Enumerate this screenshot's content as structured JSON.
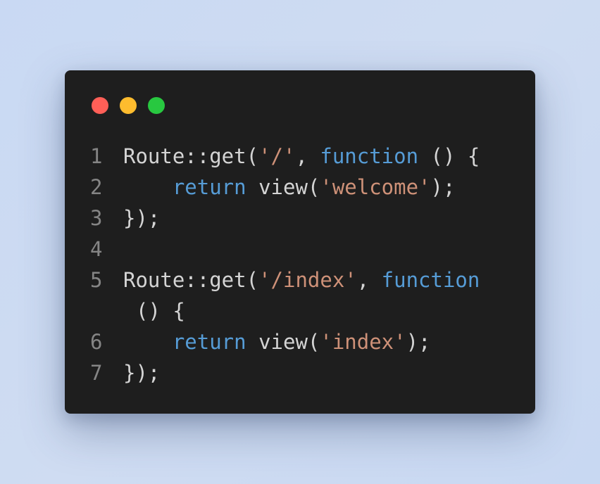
{
  "window": {
    "traffic_lights": [
      {
        "name": "close",
        "color": "#ff5f57"
      },
      {
        "name": "minimize",
        "color": "#febc2e"
      },
      {
        "name": "maximize",
        "color": "#28c840"
      }
    ]
  },
  "code": {
    "lines": [
      {
        "number": "1",
        "tokens": [
          {
            "t": "pl",
            "v": "Route::get("
          },
          {
            "t": "str",
            "v": "'/'"
          },
          {
            "t": "pl",
            "v": ", "
          },
          {
            "t": "kw",
            "v": "function"
          },
          {
            "t": "pl",
            "v": " () {"
          }
        ]
      },
      {
        "number": "2",
        "tokens": [
          {
            "t": "pl",
            "v": "    "
          },
          {
            "t": "kw",
            "v": "return"
          },
          {
            "t": "pl",
            "v": " view("
          },
          {
            "t": "str",
            "v": "'welcome'"
          },
          {
            "t": "pl",
            "v": ");"
          }
        ]
      },
      {
        "number": "3",
        "tokens": [
          {
            "t": "pl",
            "v": "});"
          }
        ]
      },
      {
        "number": "4",
        "tokens": []
      },
      {
        "number": "5",
        "tokens": [
          {
            "t": "pl",
            "v": "Route::get("
          },
          {
            "t": "str",
            "v": "'/index'"
          },
          {
            "t": "pl",
            "v": ", "
          },
          {
            "t": "kw",
            "v": "function"
          }
        ]
      },
      {
        "number": "",
        "wrapped": true,
        "tokens": [
          {
            "t": "pl",
            "v": "() {"
          }
        ]
      },
      {
        "number": "6",
        "tokens": [
          {
            "t": "pl",
            "v": "    "
          },
          {
            "t": "kw",
            "v": "return"
          },
          {
            "t": "pl",
            "v": " view("
          },
          {
            "t": "str",
            "v": "'index'"
          },
          {
            "t": "pl",
            "v": ");"
          }
        ]
      },
      {
        "number": "7",
        "tokens": [
          {
            "t": "pl",
            "v": "});"
          }
        ]
      }
    ]
  }
}
